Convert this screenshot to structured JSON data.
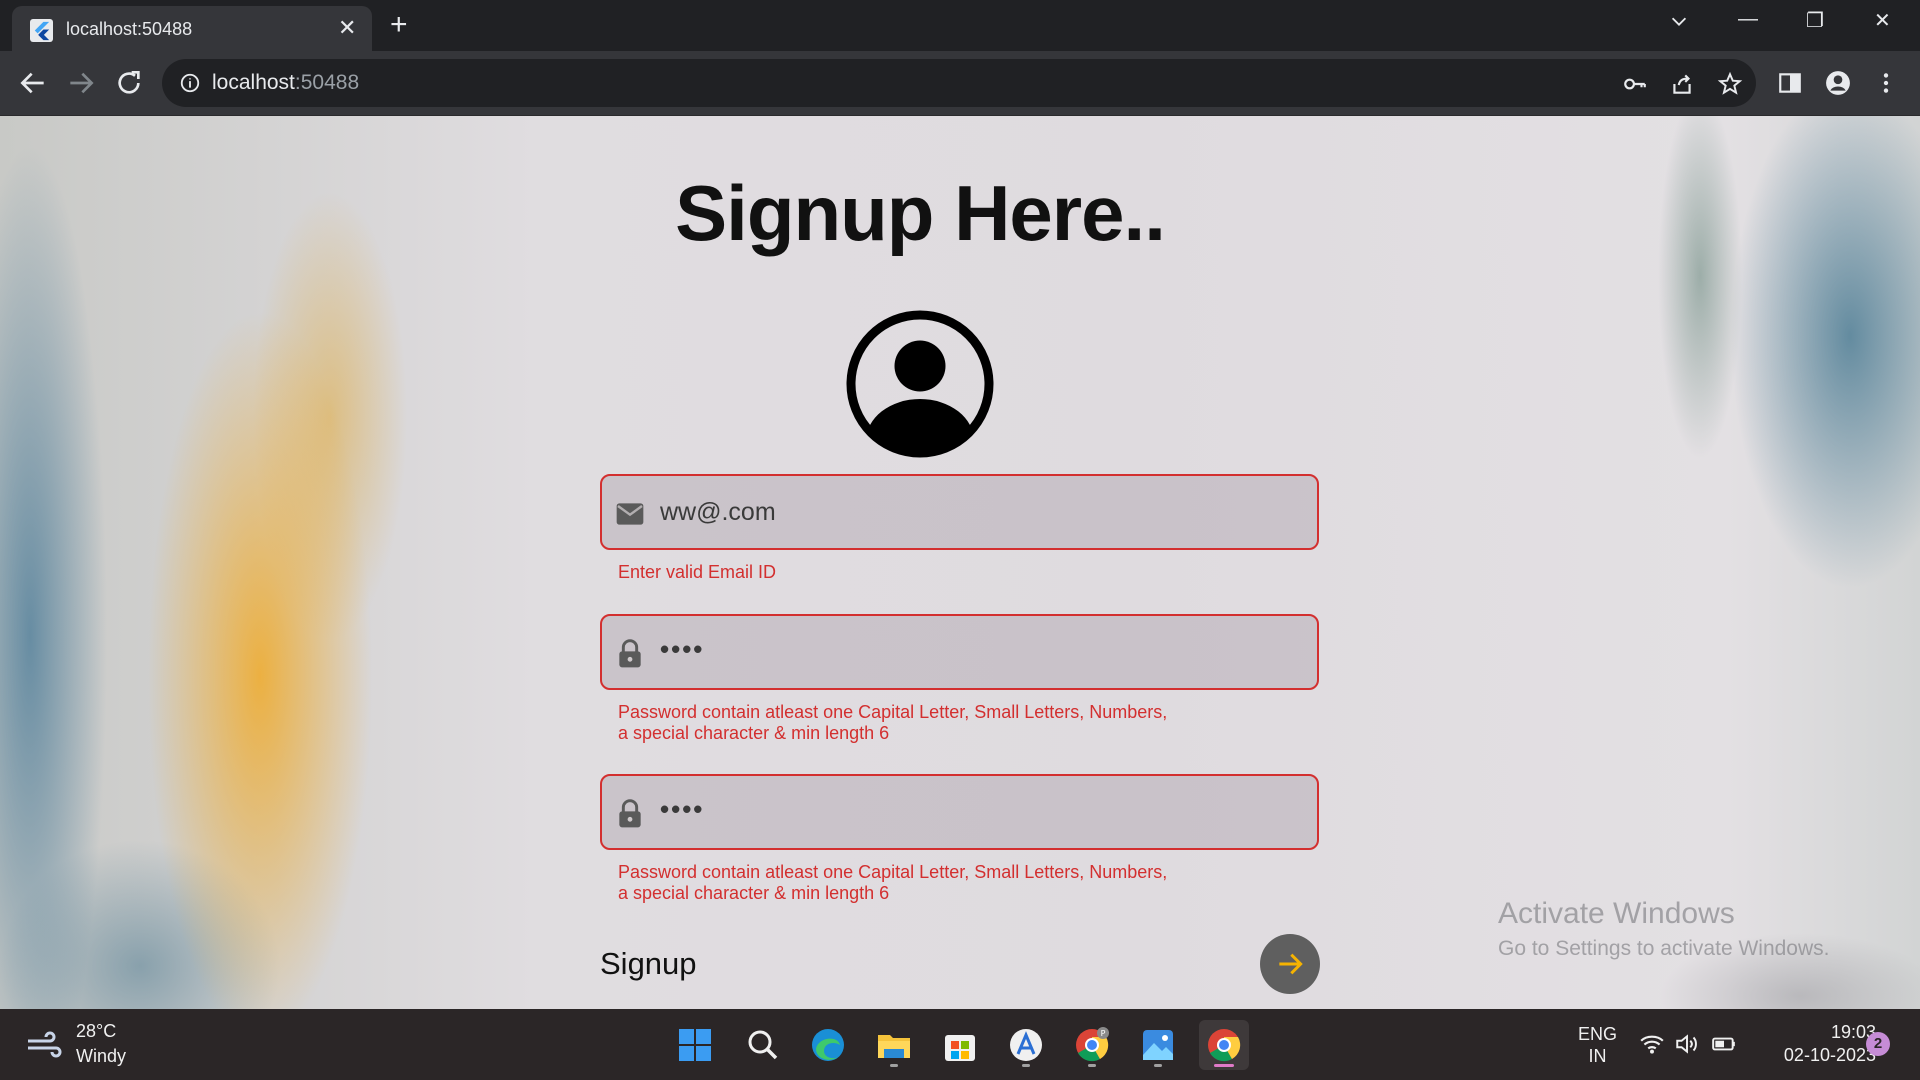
{
  "browser": {
    "tab_title": "localhost:50488",
    "tab_close": "✕",
    "new_tab": "+",
    "url_host": "localhost",
    "url_port": ":50488",
    "window_controls": {
      "minimize": "—",
      "restore": "❐",
      "close": "✕"
    }
  },
  "page": {
    "title": "Signup Here..",
    "email": {
      "value": "ww@.com",
      "error": "Enter valid Email ID"
    },
    "password": {
      "value": "••••",
      "error_line1": "Password contain atleast one Capital Letter, Small Letters, Numbers,",
      "error_line2": "a special character & min length 6"
    },
    "confirm_password": {
      "value": "••••",
      "error_line1": "Password contain atleast one Capital Letter, Small Letters, Numbers,",
      "error_line2": "a special character & min length 6"
    },
    "signup_label": "Signup",
    "colors": {
      "error": "#d32f2f",
      "button_bg": "#5f5f5f",
      "arrow": "#f5b301"
    }
  },
  "watermark": {
    "title": "Activate Windows",
    "subtitle": "Go to Settings to activate Windows."
  },
  "taskbar": {
    "weather_temp": "28°C",
    "weather_desc": "Windy",
    "apps": [
      "windows-start",
      "search",
      "edge",
      "file-explorer",
      "microsoft-store",
      "app-installer",
      "chrome-profile",
      "photos",
      "chrome"
    ],
    "lang_line1": "ENG",
    "lang_line2": "IN",
    "time": "19:03",
    "date": "02-10-2023",
    "notification_count": "2"
  }
}
